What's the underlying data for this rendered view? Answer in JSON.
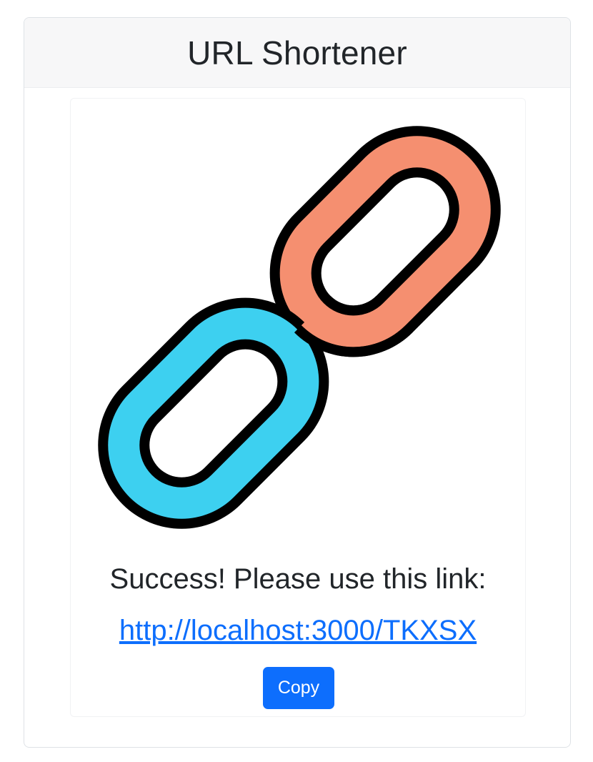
{
  "header": {
    "title": "URL Shortener"
  },
  "logo": {
    "icon": "chain-link-icon",
    "colors": {
      "front_link": "#3dd0f0",
      "back_link": "#f58f70",
      "outline": "#000000"
    }
  },
  "result": {
    "message": "Success! Please use this link:",
    "short_url": "http://localhost:3000/TKXSX"
  },
  "actions": {
    "copy_label": "Copy"
  },
  "theme": {
    "primary": "#0d6efd",
    "header_bg": "#f7f7f8",
    "text": "#212529"
  }
}
